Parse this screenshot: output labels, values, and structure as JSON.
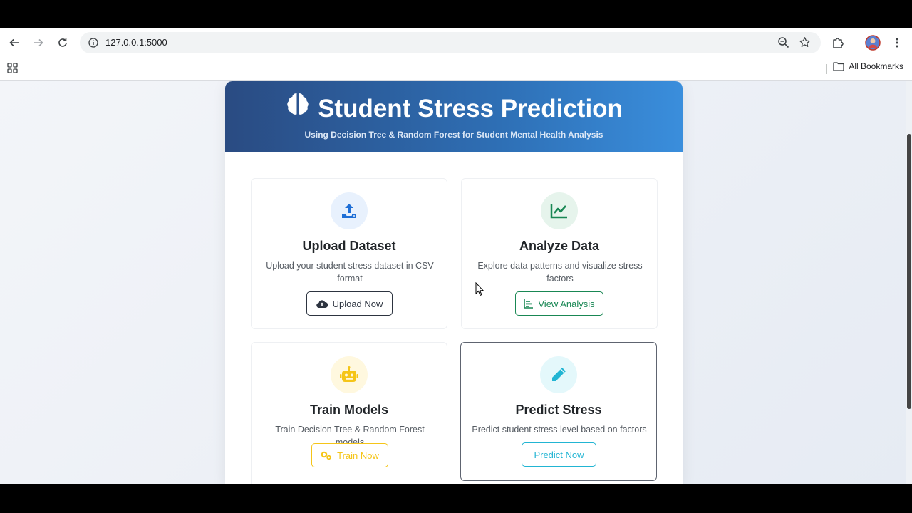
{
  "browser": {
    "url": "127.0.0.1:5000",
    "bookmarks_label": "All Bookmarks"
  },
  "page": {
    "title": "Student Stress Prediction",
    "subtitle": "Using Decision Tree & Random Forest for Student Mental Health Analysis"
  },
  "cards": [
    {
      "title": "Upload Dataset",
      "description": "Upload your student stress dataset in CSV format",
      "button_label": "Upload Now",
      "icon": "upload-icon",
      "accent": "#1f6fd6"
    },
    {
      "title": "Analyze Data",
      "description": "Explore data patterns and visualize stress factors",
      "button_label": "View Analysis",
      "icon": "chart-line-icon",
      "accent": "#198754"
    },
    {
      "title": "Train Models",
      "description": "Train Decision Tree & Random Forest models",
      "button_label": "Train Now",
      "icon": "robot-icon",
      "accent": "#f5c518"
    },
    {
      "title": "Predict Stress",
      "description": "Predict student stress level based on factors",
      "button_label": "Predict Now",
      "icon": "pen-icon",
      "accent": "#22b5d3"
    }
  ]
}
